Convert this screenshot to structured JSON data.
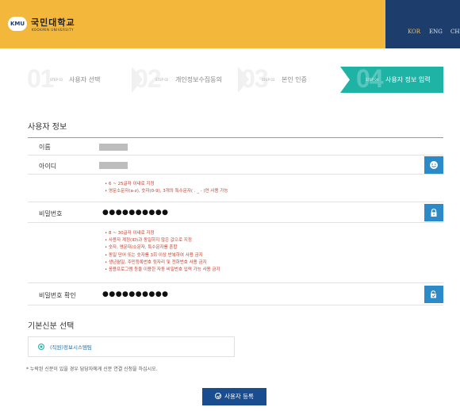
{
  "header": {
    "logo_badge": "KMU",
    "logo_title": "국민대학교",
    "logo_subtitle": "KOOKMIN UNIVERSITY",
    "languages": [
      "KOR",
      "ENG",
      "CHN"
    ]
  },
  "steps": [
    {
      "num": "01",
      "tag": "STEP 01",
      "label": "사용자 선택",
      "active": false
    },
    {
      "num": "02",
      "tag": "STEP 02",
      "label": "개인정보수집동의",
      "active": false
    },
    {
      "num": "03",
      "tag": "STEP 03",
      "label": "본인 인증",
      "active": false
    },
    {
      "num": "04",
      "tag": "STEP 04",
      "label": "사용자 정보 입력",
      "active": true
    }
  ],
  "user_info": {
    "title": "사용자 정보",
    "name_label": "이름",
    "id_label": "아이디",
    "id_rules": [
      "6 ~ 25글자 이내로 지정",
      "영문소문자(a-z), 숫자(0-9), 3개의 특수문자( . _ - )만 사용 가능"
    ],
    "password_label": "비밀번호",
    "password_value": "●●●●●●●●●●",
    "password_rules": [
      "8 ~ 30글자 이내로 지정",
      "사용자 계정(ID)과 동일하지 않은 값으로 지정",
      "숫자, 영문대/소문자, 특수문자를 혼합",
      "동일 단어 또는 숫자를 3회 이상 반복하여 사용 금지",
      "생년월일, 주민등록번호 뒷자리 및 전화번호 사용 금지",
      "응용프로그램 등을 이용한 자동 비밀번호 입력 가능 사용 금지"
    ],
    "password_confirm_label": "비밀번호 확인",
    "password_confirm_value": "●●●●●●●●●●"
  },
  "identity": {
    "title": "기본신분 선택",
    "option_label": "(직원)정보시스템팀",
    "note": "* 누락된 신분이 있을 경우 담당자에게 신분 연결 신청을 하십시오."
  },
  "register_button": "사용자 등록",
  "colors": {
    "header": "#f3b83b",
    "lang_bar": "#1d3d6c",
    "active_step": "#1fb3a6",
    "icon_button": "#2d8ac9",
    "rule_text": "#c23b2a",
    "register_button": "#1a4d8f"
  },
  "icons": [
    "smile-icon",
    "lock-icon",
    "lock-check-icon",
    "check-circle-icon"
  ]
}
